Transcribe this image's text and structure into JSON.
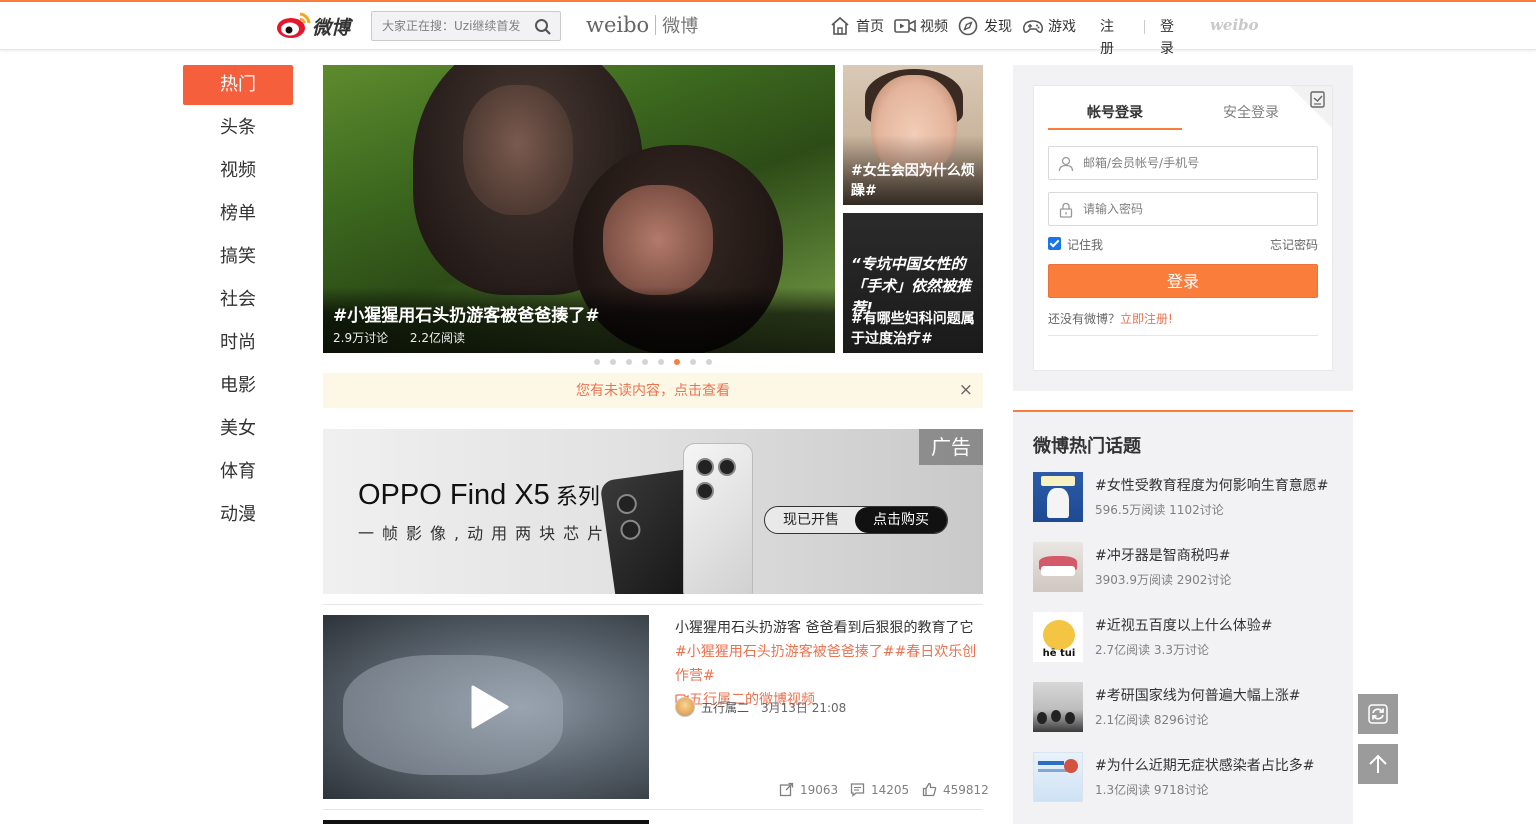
{
  "header": {
    "logo_text": "微博",
    "search_placeholder": "大家正在搜：Uzi继续首发",
    "brand_en": "weibo",
    "brand_cn": "微博",
    "nav": {
      "home": "首页",
      "video": "视频",
      "discover": "发现",
      "game": "游戏",
      "register": "注册",
      "login": "登录"
    },
    "weibo_mini": "weibo"
  },
  "left_nav": [
    "热门",
    "头条",
    "视频",
    "榜单",
    "搞笑",
    "社会",
    "时尚",
    "电影",
    "美女",
    "体育",
    "动漫"
  ],
  "carousel": {
    "main_title": "#小猩猩用石头扔游客被爸爸揍了#",
    "main_discuss": "2.9万讨论",
    "main_read": "2.2亿阅读",
    "side1_text": "#女生会因为什么烦躁#",
    "side2_quote": "“专坑中国女性的「手术」依然被推荐!",
    "side2_text": "#有哪些妇科问题属于过度治疗#",
    "dot_count": 8,
    "active_dot": 5
  },
  "notice": {
    "text": "您有未读内容，点击查看",
    "close": "×"
  },
  "ad": {
    "title": "OPPO Find X5",
    "title_suffix": "系列",
    "subtitle": "一帧影像,动用两块芯片",
    "badge": "广告",
    "pill_left": "现已开售",
    "pill_right": "点击购买"
  },
  "post": {
    "title": "小猩猩用石头扔游客 爸爸看到后狠狠的教育了它",
    "tags": "#小猩猩用石头扔游客被爸爸揍了##春日欢乐创作营#",
    "video_link": "五行属二的微博视频",
    "author": "五行属二",
    "time": "3月13日 21:08",
    "reposts": "19063",
    "comments": "14205",
    "likes": "459812"
  },
  "login": {
    "tab_account": "帐号登录",
    "tab_secure": "安全登录",
    "username_placeholder": "邮箱/会员帐号/手机号",
    "password_placeholder": "请输入密码",
    "remember": "记住我",
    "forgot": "忘记密码",
    "button": "登录",
    "no_account": "还没有微博？",
    "register_now": "立即注册!"
  },
  "topics": {
    "title": "微博热门话题",
    "items": [
      {
        "title": "#女性受教育程度为何影响生育意愿#",
        "meta": "596.5万阅读 1102讨论"
      },
      {
        "title": "#冲牙器是智商税吗#",
        "meta": "3903.9万阅读 2902讨论"
      },
      {
        "title": "#近视五百度以上什么体验#",
        "meta": "2.7亿阅读 3.3万讨论"
      },
      {
        "title": "#考研国家线为何普遍大幅上涨#",
        "meta": "2.1亿阅读 8296讨论"
      },
      {
        "title": "#为什么近期无症状感染者占比多#",
        "meta": "1.3亿阅读 9718讨论"
      }
    ],
    "thumb3_text": "hē tui"
  },
  "colors": {
    "accent": "#fa7d3c",
    "active_nav": "#f55f3c",
    "link": "#eb7350"
  }
}
